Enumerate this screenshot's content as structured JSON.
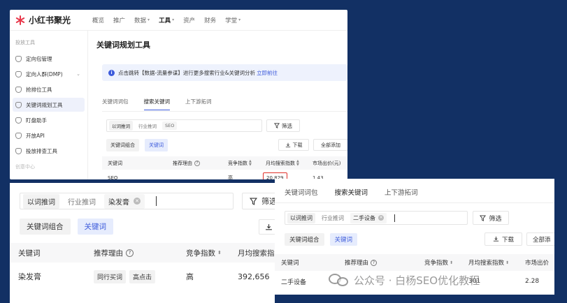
{
  "brand": {
    "name": "小红书聚光"
  },
  "nav": [
    {
      "label": "概览"
    },
    {
      "label": "推广"
    },
    {
      "label": "数据",
      "caret": "▾"
    },
    {
      "label": "工具",
      "caret": "▾",
      "active": true
    },
    {
      "label": "资产"
    },
    {
      "label": "财务"
    },
    {
      "label": "学堂",
      "caret": "▾"
    }
  ],
  "sidebar": {
    "section": "投放工具",
    "items": [
      {
        "label": "定向包管理"
      },
      {
        "label": "定向人群(DMP)",
        "chevron": "⌄"
      },
      {
        "label": "抢排位工具"
      },
      {
        "label": "关键词规划工具",
        "active": true
      },
      {
        "label": "盯盘助手"
      },
      {
        "label": "开放API"
      },
      {
        "label": "投放排查工具"
      }
    ],
    "faded": "创意中心"
  },
  "main": {
    "title": "关键词规划工具",
    "notice": {
      "text": "点击跳转【数据-流量参谋】进行更多搜索行业&关键词分析",
      "link": "立即前往"
    },
    "tabs": [
      "关键词词包",
      "搜索关键词",
      "上下游拓词"
    ],
    "search": {
      "chips": [
        "以词推词",
        "行业推词",
        "SEO"
      ]
    },
    "filter": "筛选",
    "modes": [
      "关键词组合",
      "关键词"
    ],
    "download": "下载",
    "add_all": "全部添加",
    "table": {
      "headers": [
        "关键词",
        "推荐理由",
        "竞争指数",
        "月均搜索指数",
        "市场出价(元)"
      ],
      "row": {
        "keyword": "SEO",
        "competition": "高",
        "monthly": "20,829",
        "bid": "1.43"
      }
    }
  },
  "zoom2": {
    "search": {
      "chips": [
        "以词推词",
        "行业推词",
        "染发膏"
      ]
    },
    "filter": "筛选",
    "modes": [
      "关键词组合",
      "关键词"
    ],
    "table": {
      "headers": [
        "关键词",
        "推荐理由",
        "竞争指数",
        "月均搜索指"
      ],
      "row": {
        "keyword": "染发膏",
        "tags": [
          "同行买词",
          "高点击"
        ],
        "competition": "高",
        "monthly": "392,656"
      }
    }
  },
  "zoom3": {
    "tabs": [
      "关键词词包",
      "搜索关键词",
      "上下游拓词"
    ],
    "search": {
      "chips": [
        "以词推词",
        "行业推词",
        "二手设备"
      ]
    },
    "filter": "筛选",
    "modes": [
      "关键词组合",
      "关键词"
    ],
    "download": "下载",
    "add_all": "全部添",
    "table": {
      "headers": [
        "关键词",
        "推荐理由",
        "竞争指数",
        "月均搜索指数",
        "市场出价"
      ],
      "row": {
        "keyword": "二手设备",
        "monthly": "301",
        "bid": "2.28"
      }
    }
  },
  "watermark": "公众号 · 白杨SEO优化教程",
  "colors": {
    "background": "#123064",
    "accent": "#3d5bdb",
    "highlight": "#e0302a",
    "brand": "#e8384b"
  }
}
